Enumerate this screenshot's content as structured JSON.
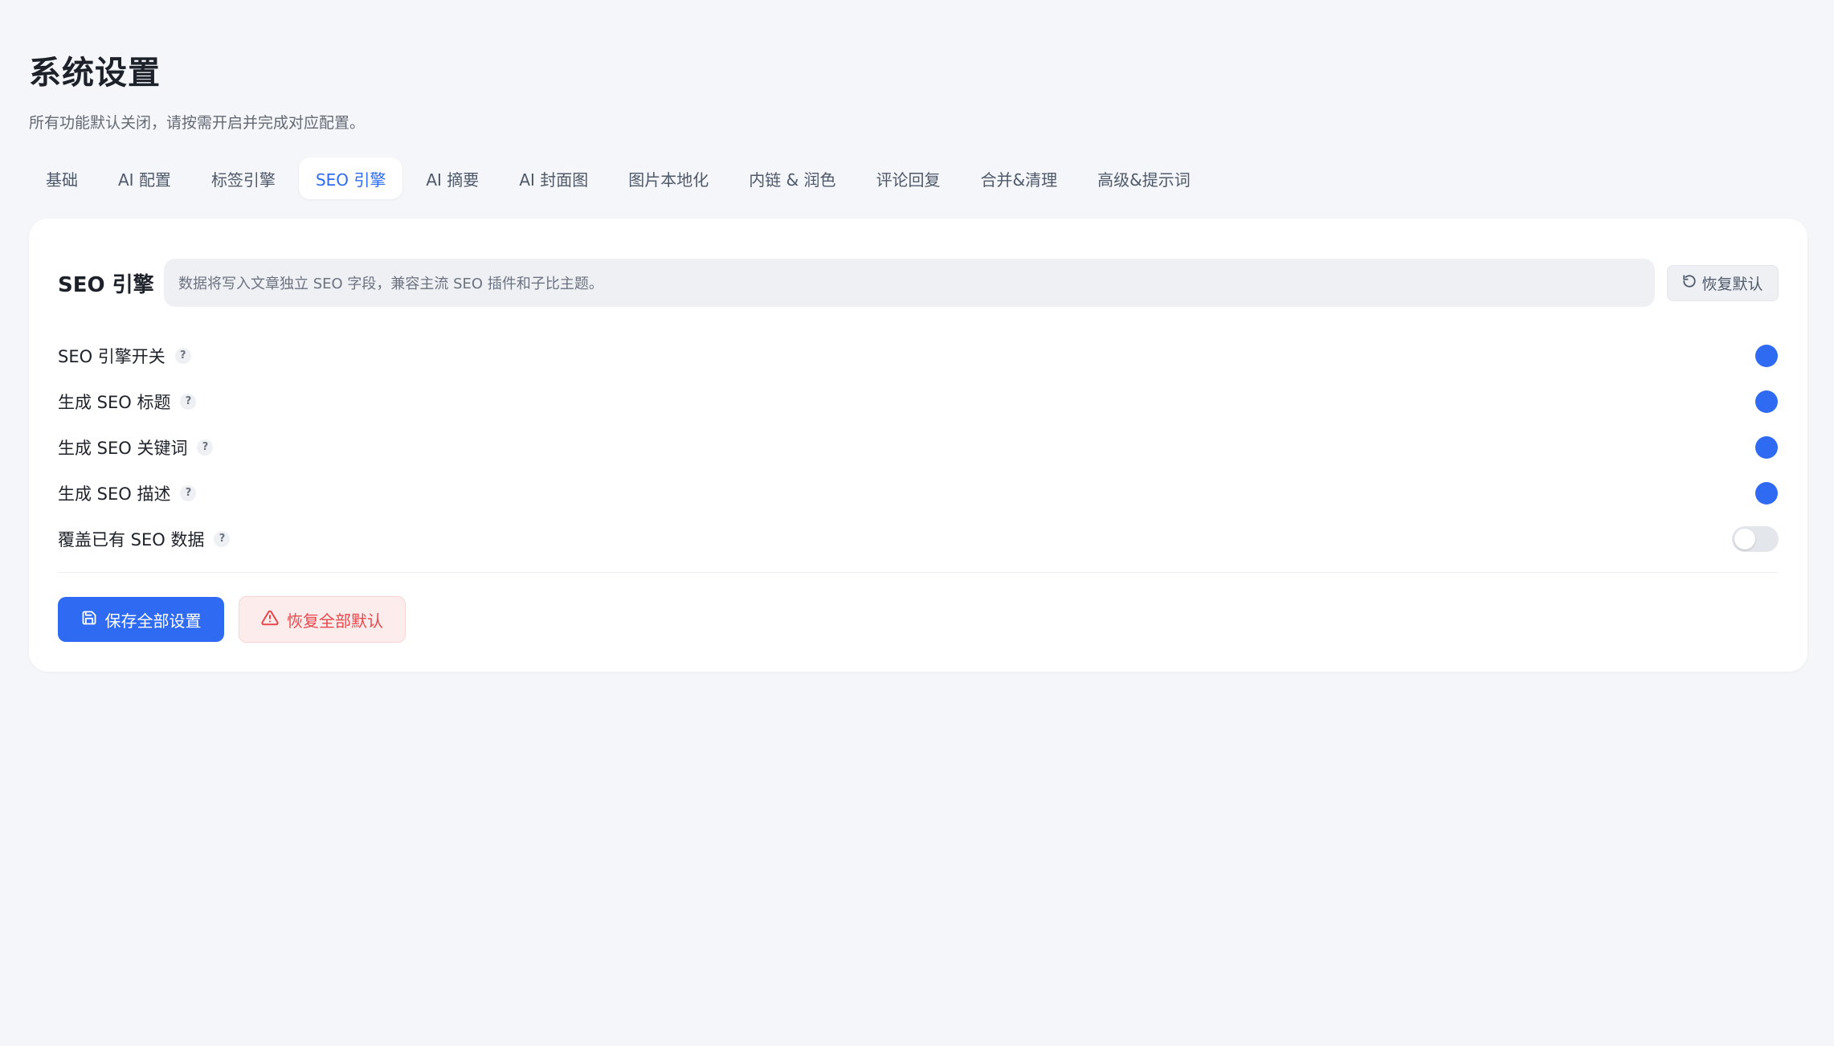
{
  "page": {
    "title": "系统设置",
    "subtitle": "所有功能默认关闭，请按需开启并完成对应配置。"
  },
  "tabs": [
    {
      "label": "基础",
      "active": false
    },
    {
      "label": "AI 配置",
      "active": false
    },
    {
      "label": "标签引擎",
      "active": false
    },
    {
      "label": "SEO 引擎",
      "active": true
    },
    {
      "label": "AI 摘要",
      "active": false
    },
    {
      "label": "AI 封面图",
      "active": false
    },
    {
      "label": "图片本地化",
      "active": false
    },
    {
      "label": "内链 & 润色",
      "active": false
    },
    {
      "label": "评论回复",
      "active": false
    },
    {
      "label": "合并&清理",
      "active": false
    },
    {
      "label": "高级&提示词",
      "active": false
    }
  ],
  "section": {
    "title": "SEO 引擎",
    "notice": "数据将写入文章独立 SEO 字段，兼容主流 SEO 插件和子比主题。",
    "reset_label": "恢复默认",
    "help_glyph": "?"
  },
  "settings": [
    {
      "label": "SEO 引擎开关",
      "enabled": true
    },
    {
      "label": "生成 SEO 标题",
      "enabled": true
    },
    {
      "label": "生成 SEO 关键词",
      "enabled": true
    },
    {
      "label": "生成 SEO 描述",
      "enabled": true
    },
    {
      "label": "覆盖已有 SEO 数据",
      "enabled": false
    }
  ],
  "actions": {
    "save_label": "保存全部设置",
    "restore_label": "恢复全部默认"
  },
  "colors": {
    "accent": "#2f6bf2",
    "danger": "#e5484d",
    "background": "#f5f6fa"
  }
}
